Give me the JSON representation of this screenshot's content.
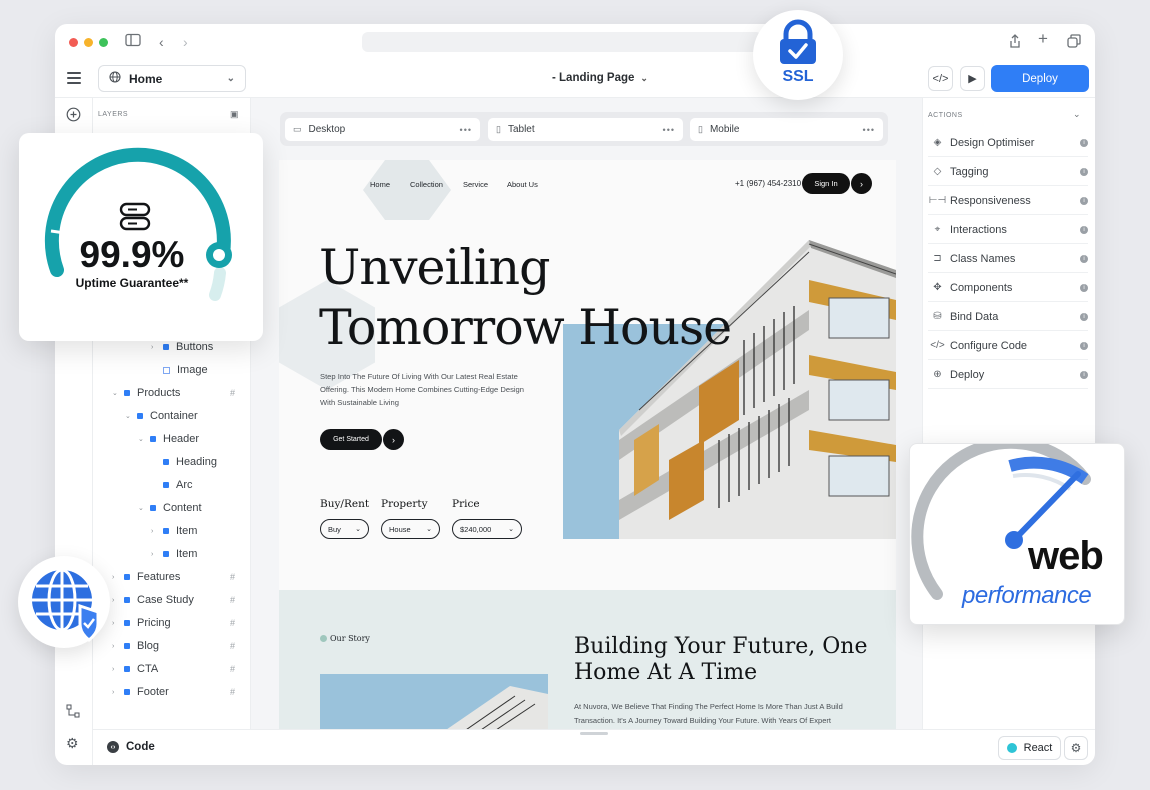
{
  "toolbar": {
    "page_select": "Home",
    "center_title": "- Landing Page",
    "deploy_label": "Deploy"
  },
  "layers": {
    "title": "LAYERS",
    "items": [
      {
        "label": "Buttons"
      },
      {
        "label": "Image"
      },
      {
        "label": "Products"
      },
      {
        "label": "Container"
      },
      {
        "label": "Header"
      },
      {
        "label": "Heading"
      },
      {
        "label": "Arc"
      },
      {
        "label": "Content"
      },
      {
        "label": "Item"
      },
      {
        "label": "Item"
      },
      {
        "label": "Features"
      },
      {
        "label": "Case Study"
      },
      {
        "label": "Pricing"
      },
      {
        "label": "Blog"
      },
      {
        "label": "CTA"
      },
      {
        "label": "Footer"
      }
    ]
  },
  "devices": [
    {
      "label": "Desktop"
    },
    {
      "label": "Tablet"
    },
    {
      "label": "Mobile"
    }
  ],
  "site": {
    "nav": [
      "Home",
      "Collection",
      "Service",
      "About Us"
    ],
    "phone": "+1 (967) 454-2310",
    "signin": "Sign In",
    "hero_title": "Unveiling Tomorrow House",
    "hero_desc": "Step Into The Future Of Living With Our Latest Real Estate Offering. This Modern Home Combines Cutting-Edge Design With Sustainable Living",
    "cta": "Get Started",
    "filters": [
      {
        "label": "Buy/Rent",
        "value": "Buy"
      },
      {
        "label": "Property",
        "value": "House"
      },
      {
        "label": "Price",
        "value": "$240,000"
      }
    ],
    "story_tag": "Our Story",
    "story_title": "Building Your Future, One Home At A Time",
    "story_text": "At Nuvora, We Believe That Finding The Perfect Home Is More Than Just A Build Transaction. It's A Journey Toward Building Your Future. With Years Of Expert"
  },
  "actions": {
    "title": "ACTIONS",
    "items": [
      {
        "label": "Design Optimiser",
        "icon": "layers-icon"
      },
      {
        "label": "Tagging",
        "icon": "tag-icon"
      },
      {
        "label": "Responsiveness",
        "icon": "responsive-icon"
      },
      {
        "label": "Interactions",
        "icon": "interaction-icon"
      },
      {
        "label": "Class Names",
        "icon": "class-icon"
      },
      {
        "label": "Components",
        "icon": "components-icon"
      },
      {
        "label": "Bind Data",
        "icon": "database-icon"
      },
      {
        "label": "Configure Code",
        "icon": "code-icon"
      },
      {
        "label": "Deploy",
        "icon": "deploy-icon"
      }
    ]
  },
  "bottom": {
    "code_label": "Code",
    "framework": "React"
  },
  "badges": {
    "uptime_value": "99.9%",
    "uptime_label": "Uptime Guarantee**",
    "ssl": "SSL",
    "perf_web": "web",
    "perf_performance": "performance"
  },
  "colors": {
    "accent": "#2f7ef6",
    "teal": "#1aa8b0",
    "ssl_blue": "#2363d6"
  }
}
